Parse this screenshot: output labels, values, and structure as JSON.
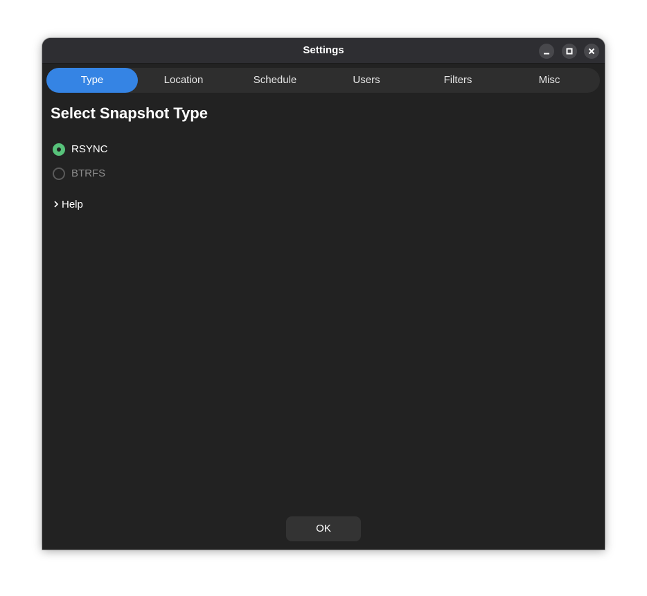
{
  "window": {
    "title": "Settings",
    "controls": {
      "minimize_icon": "minimize-icon",
      "maximize_icon": "maximize-icon",
      "close_icon": "close-icon"
    }
  },
  "tabs": [
    {
      "label": "Type",
      "active": true
    },
    {
      "label": "Location",
      "active": false
    },
    {
      "label": "Schedule",
      "active": false
    },
    {
      "label": "Users",
      "active": false
    },
    {
      "label": "Filters",
      "active": false
    },
    {
      "label": "Misc",
      "active": false
    }
  ],
  "content": {
    "heading": "Select Snapshot Type",
    "options": [
      {
        "label": "RSYNC",
        "selected": true,
        "enabled": true
      },
      {
        "label": "BTRFS",
        "selected": false,
        "enabled": false
      }
    ],
    "help": {
      "label": "Help",
      "icon": "chevron-right-icon",
      "expanded": false
    }
  },
  "footer": {
    "ok_label": "OK"
  },
  "colors": {
    "accent": "#3584e4",
    "radio_selected": "#57c27a",
    "background": "#222222",
    "titlebar": "#2e2e32"
  }
}
